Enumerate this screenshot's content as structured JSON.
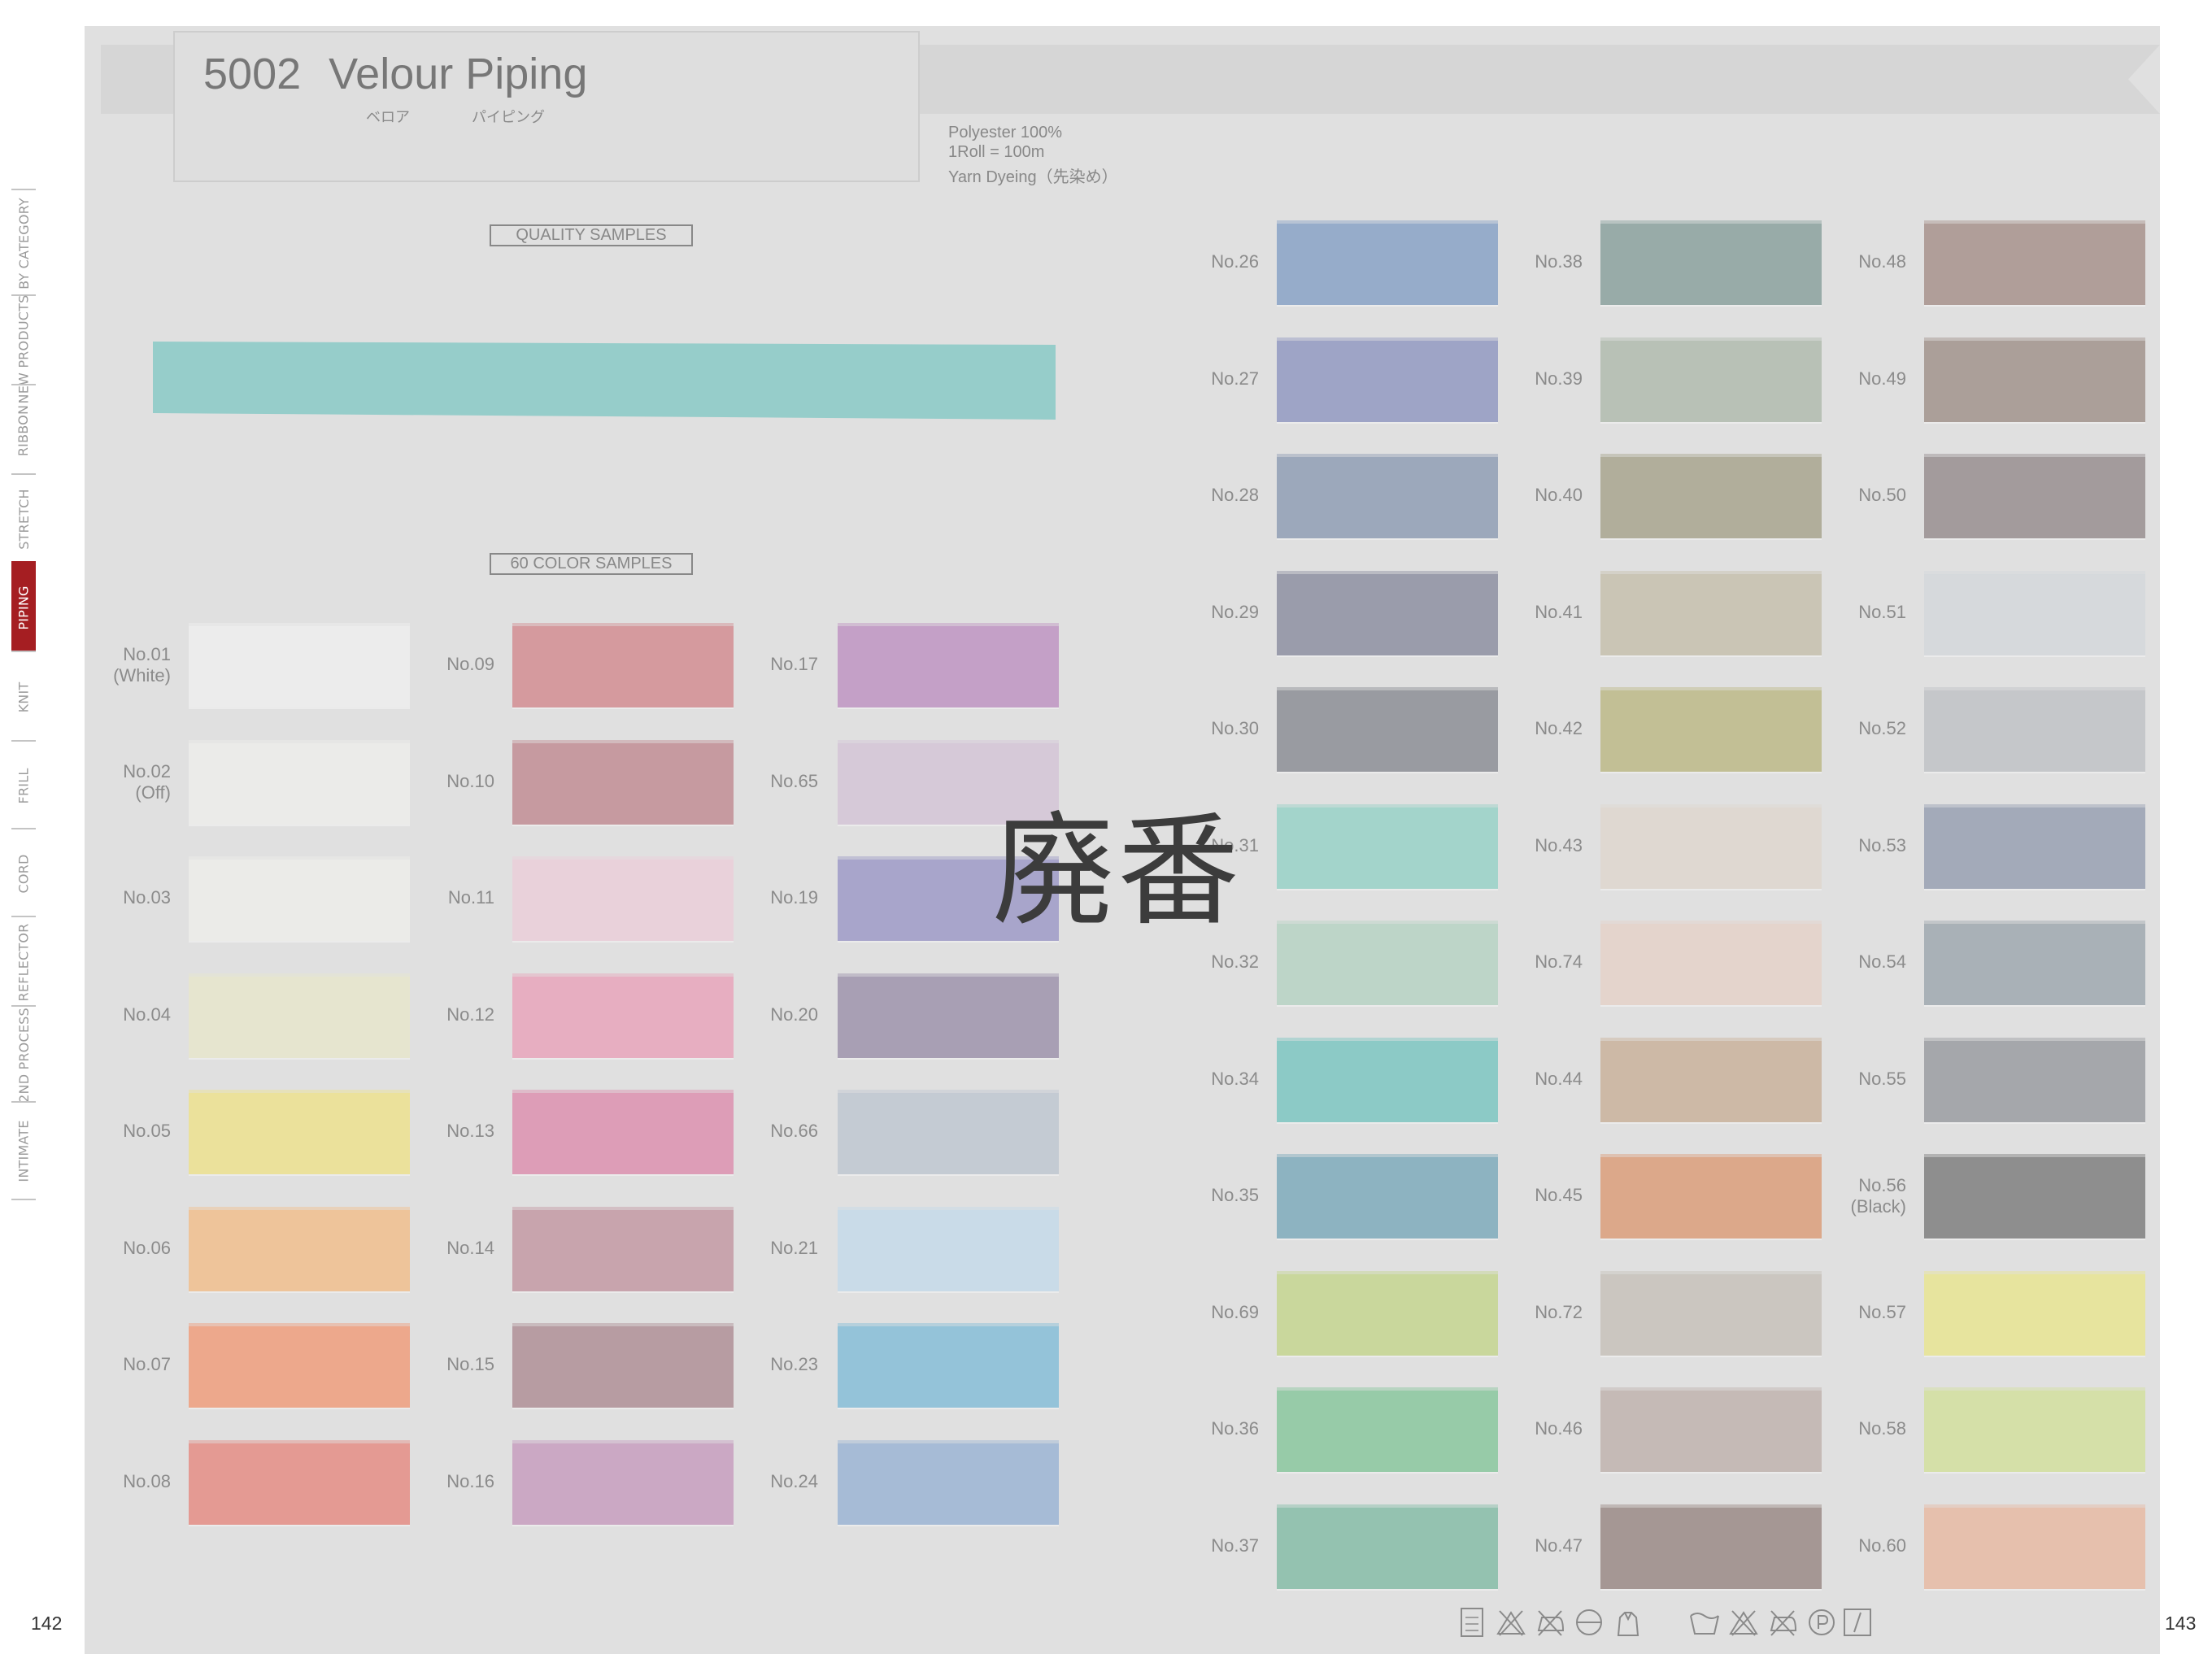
{
  "side_tabs": [
    {
      "label": "BY CATEGORY",
      "active": false
    },
    {
      "label": "NEW PRODUCTS",
      "active": false
    },
    {
      "label": "RIBBON",
      "active": false
    },
    {
      "label": "STRETCH",
      "active": false
    },
    {
      "label": "PIPING",
      "active": true
    },
    {
      "label": "KNIT",
      "active": false
    },
    {
      "label": "FRILL",
      "active": false
    },
    {
      "label": "CORD",
      "active": false
    },
    {
      "label": "REFLECTOR",
      "active": false
    },
    {
      "label": "2ND PROCESS",
      "active": false
    },
    {
      "label": "INTIMATE",
      "active": false
    }
  ],
  "page_numbers": {
    "left": "142",
    "right": "143"
  },
  "product": {
    "code": "5002",
    "name": "Velour Piping",
    "kana_1": "ベロア",
    "kana_2": "パイピング",
    "spec_1": "Polyester 100%",
    "spec_2": "1Roll = 100m",
    "spec_3": "Yarn Dyeing（先染め）"
  },
  "sections": {
    "quality": "QUALITY SAMPLES",
    "colors": "60 COLOR SAMPLES"
  },
  "quality_sample_color": "#96cdca",
  "overlay_stamp": "廃番",
  "swatches": [
    {
      "label": "No.01",
      "sub": "(White)",
      "color": "#ececec"
    },
    {
      "label": "No.02",
      "sub": "(Off)",
      "color": "#ebebe9"
    },
    {
      "label": "No.03",
      "color": "#ebebe8"
    },
    {
      "label": "No.04",
      "color": "#e6e5cf"
    },
    {
      "label": "No.05",
      "color": "#ebe19b"
    },
    {
      "label": "No.06",
      "color": "#eec49a"
    },
    {
      "label": "No.07",
      "color": "#eda88c"
    },
    {
      "label": "No.08",
      "color": "#e49a93"
    },
    {
      "label": "No.09",
      "color": "#d59a9e"
    },
    {
      "label": "No.10",
      "color": "#c69aa0"
    },
    {
      "label": "No.11",
      "color": "#e9d1da"
    },
    {
      "label": "No.12",
      "color": "#e7aec1"
    },
    {
      "label": "No.13",
      "color": "#dd9db7"
    },
    {
      "label": "No.14",
      "color": "#c8a4ad"
    },
    {
      "label": "No.15",
      "color": "#b79ca2"
    },
    {
      "label": "No.16",
      "color": "#cba8c4"
    },
    {
      "label": "No.17",
      "color": "#c4a0c7"
    },
    {
      "label": "No.65",
      "color": "#d6c9d8"
    },
    {
      "label": "No.19",
      "color": "#a8a5cb"
    },
    {
      "label": "No.20",
      "color": "#a89fb4"
    },
    {
      "label": "No.66",
      "color": "#c4cbd3"
    },
    {
      "label": "No.21",
      "color": "#c9dbe8"
    },
    {
      "label": "No.23",
      "color": "#94c3d9"
    },
    {
      "label": "No.24",
      "color": "#a6bbd6"
    },
    {
      "label": "No.26",
      "color": "#96acca"
    },
    {
      "label": "No.27",
      "color": "#9ea4c6"
    },
    {
      "label": "No.28",
      "color": "#9ca8bb"
    },
    {
      "label": "No.29",
      "color": "#9a9cab"
    },
    {
      "label": "No.30",
      "color": "#999ba1"
    },
    {
      "label": "No.31",
      "color": "#a3d4cb"
    },
    {
      "label": "No.32",
      "color": "#bdd5c8"
    },
    {
      "label": "No.34",
      "color": "#8ccac6"
    },
    {
      "label": "No.35",
      "color": "#8db3c1"
    },
    {
      "label": "No.69",
      "color": "#c9d79c"
    },
    {
      "label": "No.36",
      "color": "#97cba8"
    },
    {
      "label": "No.37",
      "color": "#94c2b0"
    },
    {
      "label": "No.38",
      "color": "#98aba8"
    },
    {
      "label": "No.39",
      "color": "#b8c1b6"
    },
    {
      "label": "No.40",
      "color": "#b1ae9b"
    },
    {
      "label": "No.41",
      "color": "#cac5b5"
    },
    {
      "label": "No.42",
      "color": "#c2bf95"
    },
    {
      "label": "No.43",
      "color": "#dfd8d1"
    },
    {
      "label": "No.74",
      "color": "#e4d4cc"
    },
    {
      "label": "No.44",
      "color": "#cdb9a6"
    },
    {
      "label": "No.45",
      "color": "#dca88a"
    },
    {
      "label": "No.72",
      "color": "#cbc6c0"
    },
    {
      "label": "No.46",
      "color": "#c5bab6"
    },
    {
      "label": "No.47",
      "color": "#a59794"
    },
    {
      "label": "No.48",
      "color": "#b09e99"
    },
    {
      "label": "No.49",
      "color": "#ab9f99"
    },
    {
      "label": "No.50",
      "color": "#a39b9c"
    },
    {
      "label": "No.51",
      "color": "#d6d9dc"
    },
    {
      "label": "No.52",
      "color": "#c5c7ca"
    },
    {
      "label": "No.53",
      "color": "#a3aab9"
    },
    {
      "label": "No.54",
      "color": "#a9b1b7"
    },
    {
      "label": "No.55",
      "color": "#a5a7ab"
    },
    {
      "label": "No.56",
      "sub": "(Black)",
      "color": "#8e8e8e"
    },
    {
      "label": "No.57",
      "color": "#e7e49e"
    },
    {
      "label": "No.58",
      "color": "#d5e0a8"
    },
    {
      "label": "No.60",
      "color": "#e6c0ad"
    }
  ],
  "care_icon_names": [
    "wash-40-icon",
    "no-bleach-icon",
    "no-iron-icon",
    "no-tumble-dry-icon",
    "hand-wash-icon",
    "wash-tub-40-icon",
    "bleach-triangle-icon",
    "no-iron-b-icon",
    "dryclean-p-icon",
    "line-dry-icon"
  ]
}
